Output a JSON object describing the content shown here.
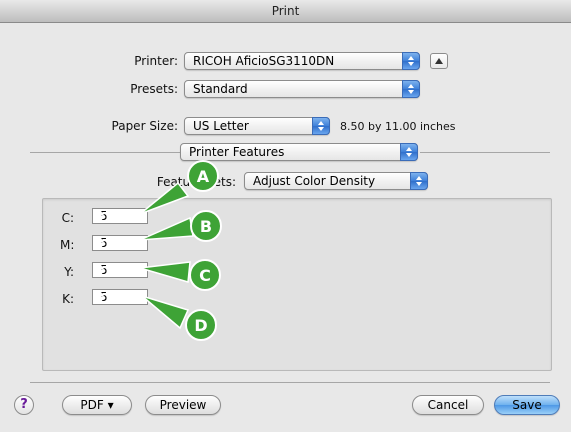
{
  "window": {
    "title": "Print"
  },
  "printer": {
    "label": "Printer:",
    "value": "RICOH AficioSG3110DN"
  },
  "presets": {
    "label": "Presets:",
    "value": "Standard"
  },
  "paper": {
    "label": "Paper Size:",
    "value": "US Letter",
    "dimensions": "8.50 by 11.00 inches"
  },
  "section": {
    "value": "Printer Features"
  },
  "feature_sets": {
    "label": "Feature Sets:",
    "value": "Adjust Color Density"
  },
  "colors": [
    {
      "label": "C:",
      "value": "5",
      "callout": "A"
    },
    {
      "label": "M:",
      "value": "5",
      "callout": "B"
    },
    {
      "label": "Y:",
      "value": "5",
      "callout": "C"
    },
    {
      "label": "K:",
      "value": "5",
      "callout": "D"
    }
  ],
  "footer": {
    "help": "?",
    "pdf": "PDF ▾",
    "preview": "Preview",
    "cancel": "Cancel",
    "save": "Save"
  },
  "callout_color": "#3ea336"
}
